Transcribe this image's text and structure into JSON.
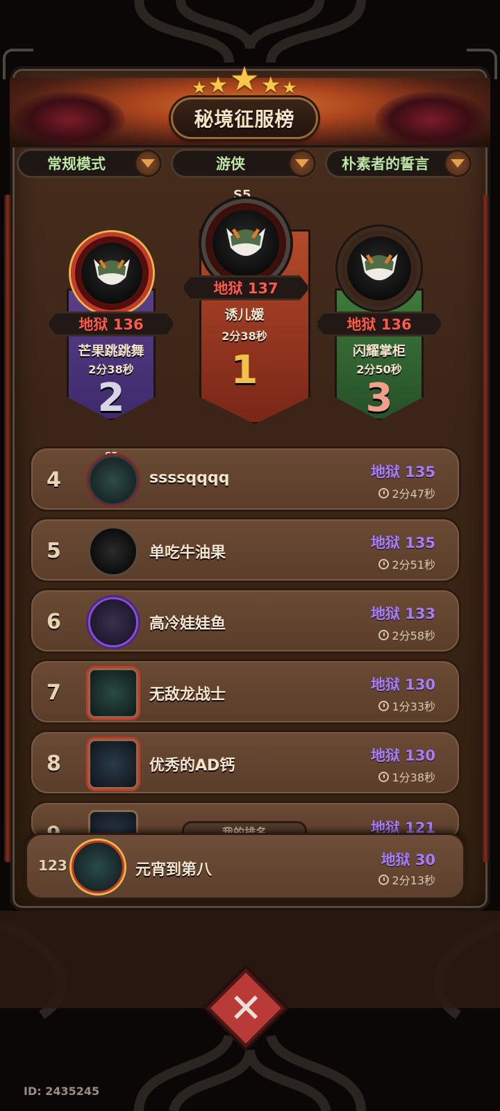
{
  "header": {
    "title": "秘境征服榜",
    "star_count": 5
  },
  "filters": [
    {
      "label": "常规模式"
    },
    {
      "label": "游侠"
    },
    {
      "label": "朴素者的誓言"
    }
  ],
  "podium": {
    "first": {
      "rank": "1",
      "season": "S5",
      "score": "地狱 137",
      "name": "诱儿媛",
      "time": "2分38秒"
    },
    "second": {
      "rank": "2",
      "score": "地狱 136",
      "name": "芒果跳跳舞",
      "time": "2分38秒"
    },
    "third": {
      "rank": "3",
      "score": "地狱 136",
      "name": "闪耀掌柜",
      "time": "2分50秒"
    }
  },
  "leaderboard": [
    {
      "rank": "4",
      "season": "S5",
      "name": "ssssqqqq",
      "score": "地狱 135",
      "time": "2分47秒"
    },
    {
      "rank": "5",
      "name": "单吃牛油果",
      "score": "地狱 135",
      "time": "2分51秒"
    },
    {
      "rank": "6",
      "name": "高冷娃娃鱼",
      "score": "地狱 133",
      "time": "2分58秒"
    },
    {
      "rank": "7",
      "name": "无敌龙战士",
      "score": "地狱 130",
      "time": "1分33秒"
    },
    {
      "rank": "8",
      "name": "优秀的AD钙",
      "score": "地狱 130",
      "time": "1分38秒"
    },
    {
      "rank": "9",
      "name": "",
      "score": "地狱 121",
      "time": ""
    }
  ],
  "my_rank": {
    "tab_label": "我的排名",
    "rank": "123",
    "name": "元宵到第八",
    "score": "地狱 30",
    "time": "2分13秒"
  },
  "footer": {
    "id_text": "ID: 2435245"
  },
  "colors": {
    "score_red": "#ff5a4a",
    "score_purple": "#a67dff",
    "filter_green": "#bfe6a4",
    "close_red": "#b93a36"
  }
}
